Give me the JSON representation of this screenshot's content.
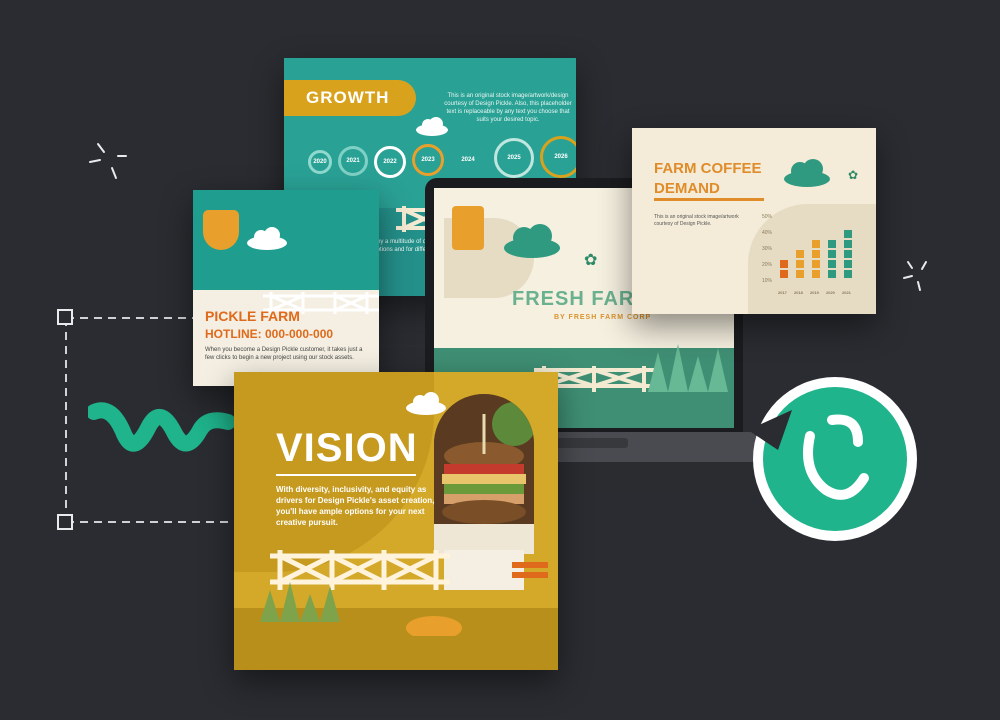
{
  "slides": {
    "growth": {
      "title": "GROWTH",
      "description": "This is an original stock image/artwork/design courtesy of Design Pickle. Also, this placeholder text is replaceable by any text you choose that suits your desired topic.",
      "years": [
        "2020",
        "2021",
        "2022",
        "2023",
        "2024",
        "2025",
        "2026"
      ],
      "footer_text": "Feel free to download and enjoy a multitude of design template. However, this template is areas of promotions and for different topics."
    },
    "pickle": {
      "title": "PICKLE FARM",
      "hotline": "HOTLINE: 000-000-000",
      "body": "When you become a Design Pickle customer, it takes just a few clicks to begin a new project using our stock assets."
    },
    "laptop": {
      "brand": "FRESH FARM CAFE",
      "subtitle": "BY FRESH FARM CORP"
    },
    "coffee": {
      "title_line1": "FARM COFFEE",
      "title_line2": "DEMAND",
      "description": "This is an original stock image/artwork courtesy of Design Pickle.",
      "percent_labels": [
        "50%",
        "40%",
        "30%",
        "20%",
        "10%"
      ],
      "years": [
        "2017",
        "2018",
        "2019",
        "2020",
        "2021"
      ]
    },
    "vision": {
      "title": "VISION",
      "body": "With diversity, inclusivity, and equity as drivers for Design Pickle's asset creation, you'll have ample options for your next creative pursuit."
    }
  },
  "colors": {
    "background": "#2a2c31",
    "teal": "#2aa195",
    "mustard": "#d4a92a",
    "orange": "#e06a1b",
    "green_brand": "#1fb48c"
  },
  "icons": [
    "cloud-icon",
    "fence-icon",
    "grass-icon",
    "sparkle-icon",
    "logo-badge-icon",
    "wave-logo-icon",
    "selection-handle-icon"
  ]
}
